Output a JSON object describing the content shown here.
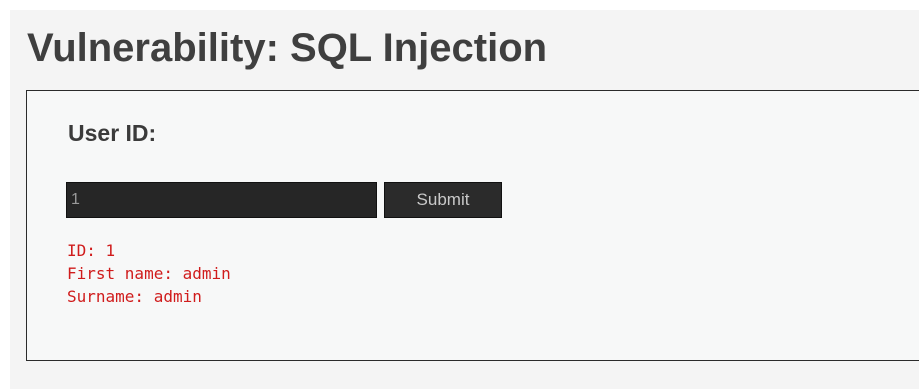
{
  "page": {
    "title": "Vulnerability: SQL Injection"
  },
  "form": {
    "label": "User ID:",
    "input_value": "1",
    "submit_label": "Submit"
  },
  "result": {
    "lines": [
      "ID: 1",
      "First name: admin",
      "Surname: admin"
    ]
  },
  "colors": {
    "background": "#f4f4f4",
    "input_background": "#262626",
    "button_background": "#2b2b2b",
    "result_text": "#d01c1c",
    "heading_text": "#3f3f3f"
  }
}
